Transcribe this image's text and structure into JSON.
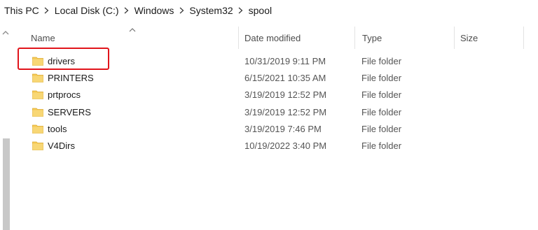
{
  "breadcrumb": [
    "This PC",
    "Local Disk (C:)",
    "Windows",
    "System32",
    "spool"
  ],
  "columns": {
    "name": "Name",
    "date_modified": "Date modified",
    "type": "Type",
    "size": "Size"
  },
  "files": [
    {
      "name": "drivers",
      "date": "10/31/2019 9:11 PM",
      "type": "File folder"
    },
    {
      "name": "PRINTERS",
      "date": "6/15/2021 10:35 AM",
      "type": "File folder"
    },
    {
      "name": "prtprocs",
      "date": "3/19/2019 12:52 PM",
      "type": "File folder"
    },
    {
      "name": "SERVERS",
      "date": "3/19/2019 12:52 PM",
      "type": "File folder"
    },
    {
      "name": "tools",
      "date": "3/19/2019 7:46 PM",
      "type": "File folder"
    },
    {
      "name": "V4Dirs",
      "date": "10/19/2022 3:40 PM",
      "type": "File folder"
    }
  ],
  "colors": {
    "highlight": "#e1141b",
    "folder": "#f6ca56"
  },
  "icons": {
    "folder": "folder-icon",
    "separator": "chevron-right-icon",
    "sort": "sort-ascending-icon"
  }
}
